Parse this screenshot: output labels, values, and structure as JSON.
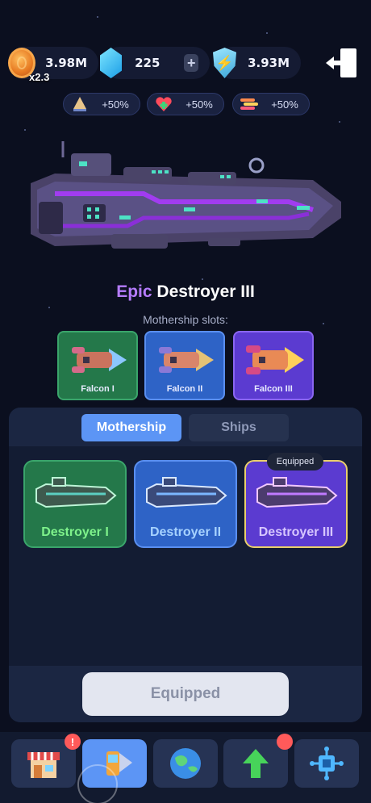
{
  "resources": {
    "coins": "3.98M",
    "coin_multiplier": "x2.3",
    "gems": "225",
    "add_label": "+",
    "energy": "3.93M"
  },
  "boosts": [
    {
      "icon": "drill-icon",
      "value": "+50%"
    },
    {
      "icon": "heart-icon",
      "value": "+50%"
    },
    {
      "icon": "fire-icon",
      "value": "+50%"
    }
  ],
  "mothership": {
    "rarity": "Epic",
    "name": "Destroyer III",
    "slots_label": "Mothership slots:",
    "slots": [
      {
        "label": "Falcon I",
        "color": "#24784a"
      },
      {
        "label": "Falcon II",
        "color": "#2e63c6"
      },
      {
        "label": "Falcon III",
        "color": "#5b3bd0"
      }
    ]
  },
  "tabs": [
    {
      "label": "Mothership",
      "active": true
    },
    {
      "label": "Ships",
      "active": false
    }
  ],
  "cards": [
    {
      "name": "Destroyer I",
      "color": "#24784a",
      "text_color": "#7ef28b"
    },
    {
      "name": "Destroyer II",
      "color": "#2e63c6",
      "text_color": "#a6d2ff"
    },
    {
      "name": "Destroyer III",
      "color": "#5b3bd0",
      "text_color": "#d7c6ff",
      "equipped": true
    }
  ],
  "equipped_tag": "Equipped",
  "equip_button": "Equipped",
  "nav": [
    {
      "icon": "shop-icon",
      "badge": "!"
    },
    {
      "icon": "ships-icon",
      "active": true
    },
    {
      "icon": "planet-icon"
    },
    {
      "icon": "upgrade-arrow-icon",
      "badge": ""
    },
    {
      "icon": "research-chip-icon"
    }
  ]
}
